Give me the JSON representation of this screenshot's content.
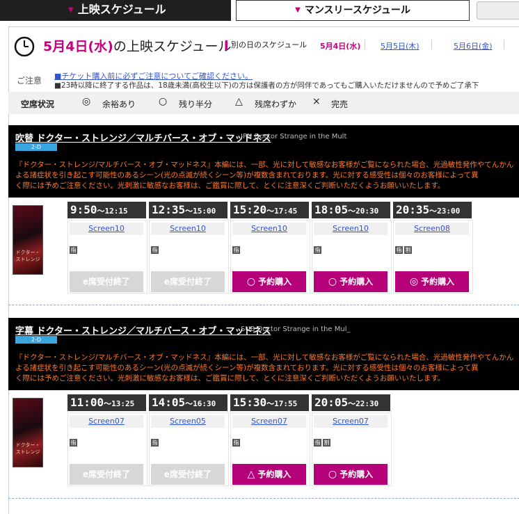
{
  "tabs": {
    "now": "上映スケジュール",
    "monthly": "マンスリースケジュール"
  },
  "header": {
    "date_highlight": "5月4日(水)",
    "date_rest": "の上映スケジュール",
    "other_label": "別の日のスケジュール",
    "days": [
      "5月4日(水)",
      "5月5日(木)",
      "5月6日(金)"
    ]
  },
  "notice": {
    "label": "ご注意",
    "link": "■チケット購入前に必ずご注意についてご確認ください。",
    "text": "■23時以降に終了する作品は、18歳未満(高校生以下)の方は保護者の方が同伴であってもご購入いただけませんので予めご了承下"
  },
  "status": {
    "title": "空席状況",
    "items": [
      {
        "icon": "◎",
        "label": "余裕あり"
      },
      {
        "icon": "○",
        "label": "残り半分"
      },
      {
        "icon": "△",
        "label": "残席わずか"
      },
      {
        "icon": "×",
        "label": "完売"
      }
    ]
  },
  "colors": {
    "accent": "#c6007e",
    "button": "#b5007a",
    "warning": "#ff7a2a",
    "badge": "#3aa6e0"
  },
  "films": [
    {
      "title": "吹替 ドクター・ストレンジ／マルチバース・オブ・マッドネス",
      "subtitle": "JPN Doctor Strange in the Mult",
      "badge": "2-D",
      "warning": [
        "『ドクター・ストレンジ/マルチバース・オブ・マッドネス』本編には、一部、光に対して敏感なお客様がご覧になられた場合、光過敏性発作やてんかん",
        "よる諸症状を引き起こす可能性のあるシーン(光の点滅が続くシーン等)が複数含まれております。光に対する感受性は個々のお客様によって異",
        "く際には予めご注意ください。光刺激に敏感なお客様は、ご鑑賞に際して、とくに注意深くご判断いただくようお願いいたします。"
      ],
      "poster_text": "ドクター・ストレンジ",
      "slots": [
        {
          "start": "9:50",
          "end": "〜12:15",
          "screen": "Screen10",
          "tags": [
            "指"
          ],
          "button": "e席受付終了",
          "active": false,
          "icon": ""
        },
        {
          "start": "12:35",
          "end": "〜15:00",
          "screen": "Screen10",
          "tags": [
            "指"
          ],
          "button": "e席受付終了",
          "active": false,
          "icon": ""
        },
        {
          "start": "15:20",
          "end": "〜17:45",
          "screen": "Screen10",
          "tags": [
            "指"
          ],
          "button": "予約購入",
          "active": true,
          "icon": "○"
        },
        {
          "start": "18:05",
          "end": "〜20:30",
          "screen": "Screen10",
          "tags": [
            "指"
          ],
          "button": "予約購入",
          "active": true,
          "icon": "○"
        },
        {
          "start": "20:35",
          "end": "〜23:00",
          "screen": "Screen08",
          "tags": [
            "指",
            "割"
          ],
          "button": "予約購入",
          "active": true,
          "icon": "◎"
        }
      ]
    },
    {
      "title": "字幕 ドクター・ストレンジ／マルチバース・オブ・マッドネス",
      "subtitle": "SUB Doctor Strange in the Mul_",
      "badge": "2-D",
      "warning": [
        "『ドクター・ストレンジ/マルチバース・オブ・マッドネス』本編には、一部、光に対して敏感なお客様がご覧になられた場合、光過敏性発作やてんかん",
        "よる諸症状を引き起こす可能性のあるシーン(光の点滅が続くシーン等)が複数含まれております。光に対する感受性は個々のお客様によって異",
        "く際には予めご注意ください。光刺激に敏感なお客様は、ご鑑賞に際して、とくに注意深くご判断いただくようお願いいたします。"
      ],
      "poster_text": "ドクター・ストレンジ",
      "slots": [
        {
          "start": "11:00",
          "end": "〜13:25",
          "screen": "Screen07",
          "tags": [
            "指"
          ],
          "button": "e席受付終了",
          "active": false,
          "icon": ""
        },
        {
          "start": "14:05",
          "end": "〜16:30",
          "screen": "Screen05",
          "tags": [
            "指"
          ],
          "button": "e席受付終了",
          "active": false,
          "icon": ""
        },
        {
          "start": "15:30",
          "end": "〜17:55",
          "screen": "Screen07",
          "tags": [
            "指"
          ],
          "button": "予約購入",
          "active": true,
          "icon": "△"
        },
        {
          "start": "20:05",
          "end": "〜22:30",
          "screen": "Screen07",
          "tags": [
            "指",
            "割"
          ],
          "button": "予約購入",
          "active": true,
          "icon": "○"
        }
      ]
    }
  ]
}
